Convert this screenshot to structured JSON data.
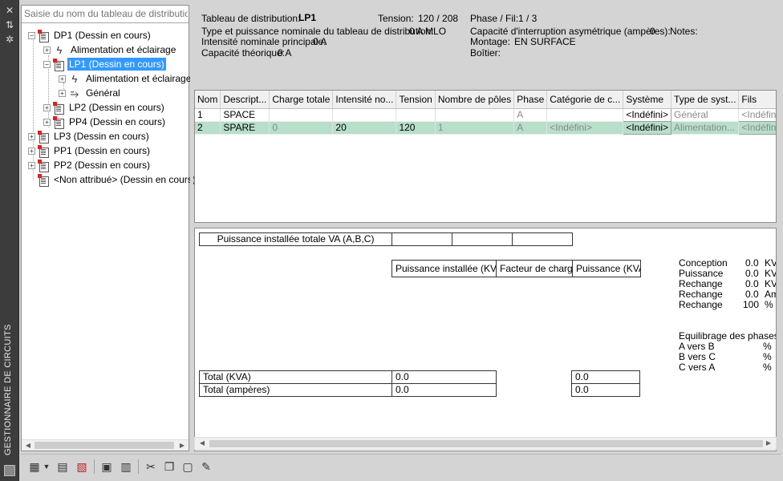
{
  "window": {
    "vertical_title": "GESTIONNAIRE DE CIRCUITS"
  },
  "tree": {
    "search_placeholder": "Saisie du nom du tableau de distribution",
    "nodes": [
      {
        "label": "DP1 (Dessin en cours)",
        "icon": "panel-icon",
        "expander": "−"
      },
      {
        "label": "Alimentation et éclairage",
        "icon": "lightning-icon",
        "expander": "+"
      },
      {
        "label": "LP1 (Dessin en cours)",
        "icon": "panel-icon",
        "expander": "−",
        "selected": true
      },
      {
        "label": "Alimentation et éclairage",
        "icon": "lightning-icon",
        "expander": "+"
      },
      {
        "label": "Général",
        "icon": "system-icon",
        "expander": "+"
      },
      {
        "label": "LP2 (Dessin en cours)",
        "icon": "panel-icon",
        "expander": "+"
      },
      {
        "label": "PP4 (Dessin en cours)",
        "icon": "panel-icon",
        "expander": "+"
      },
      {
        "label": "LP3 (Dessin en cours)",
        "icon": "panel-icon",
        "expander": "+"
      },
      {
        "label": "PP1 (Dessin en cours)",
        "icon": "panel-icon",
        "expander": "+"
      },
      {
        "label": "PP2 (Dessin en cours)",
        "icon": "panel-icon",
        "expander": "+"
      },
      {
        "label": "<Non attribué> (Dessin en cours)",
        "icon": "panel-icon",
        "expander": ""
      }
    ]
  },
  "info": {
    "panel_label": "Tableau de distribution:",
    "panel_value": "LP1",
    "tension_label": "Tension:",
    "tension_value": "120 / 208",
    "phase_label": "Phase / Fil:",
    "phase_value": "1 / 3",
    "rating_label": "Type et puissance nominale du tableau de distribution:",
    "rating_value": "0 A MLO",
    "interrupt_label": "Capacité d'interruption asymétrique (ampères):",
    "interrupt_value": "0",
    "notes_label": "Notes:",
    "main_current_label": "Intensité nominale principale:",
    "main_current_value": "0 A",
    "mounting_label": "Montage:",
    "mounting_value": "EN SURFACE",
    "capacity_label": "Capacité théorique:",
    "capacity_value": "0 A",
    "enclosure_label": "Boîtier:"
  },
  "circuits": {
    "columns": [
      "Nom",
      "Descript...",
      "Charge totale",
      "Intensité no...",
      "Tension",
      "Nombre de pôles",
      "Phase",
      "Catégorie de c...",
      "Système",
      "Type de syst...",
      "Fils"
    ],
    "rows": [
      [
        "1",
        "SPACE",
        "",
        "",
        "",
        "",
        "A",
        "",
        "<Indéfini>",
        "Général",
        "<Indéfini>"
      ],
      [
        "2",
        "SPARE",
        "0",
        "20",
        "120",
        "1",
        "A",
        "<Indéfini>",
        "<Indéfini>",
        "Alimentation...",
        "<Indéfini>"
      ]
    ]
  },
  "summary": {
    "total_installed_label": "Puissance installée totale VA (A,B,C)",
    "installed_kva_label": "Puissance installée (KVA)",
    "load_factor_label": "Facteur de charge",
    "power_kva_label": "Puissance (KVA)",
    "total_kva_label": "Total (KVA)",
    "total_kva_value": "0.0",
    "total_kva_power": "0.0",
    "total_amps_label": "Total (ampères)",
    "total_amps_value": "0.0",
    "total_amps_power": "0.0",
    "side": [
      {
        "label": "Conception",
        "value": "0.0",
        "unit": "KVA"
      },
      {
        "label": "Puissance",
        "value": "0.0",
        "unit": "KVA"
      },
      {
        "label": "Rechange",
        "value": "0.0",
        "unit": "KVA"
      },
      {
        "label": "Rechange",
        "value": "0.0",
        "unit": "Amp"
      },
      {
        "label": "Rechange",
        "value": "100",
        "unit": "%"
      }
    ],
    "balance_title": "Equilibrage des phases",
    "balance": [
      {
        "label": "A vers B",
        "unit": "%"
      },
      {
        "label": "B vers C",
        "unit": "%"
      },
      {
        "label": "C vers A",
        "unit": "%"
      }
    ]
  },
  "toolbar": {
    "icons": [
      "new-panel-icon",
      "dropdown-arrow-icon",
      "new-circuit-icon",
      "delete-circuit-icon",
      "properties-icon",
      "schedule-icon",
      "cut-icon",
      "copy-icon",
      "paste-icon",
      "assign-icon"
    ]
  }
}
